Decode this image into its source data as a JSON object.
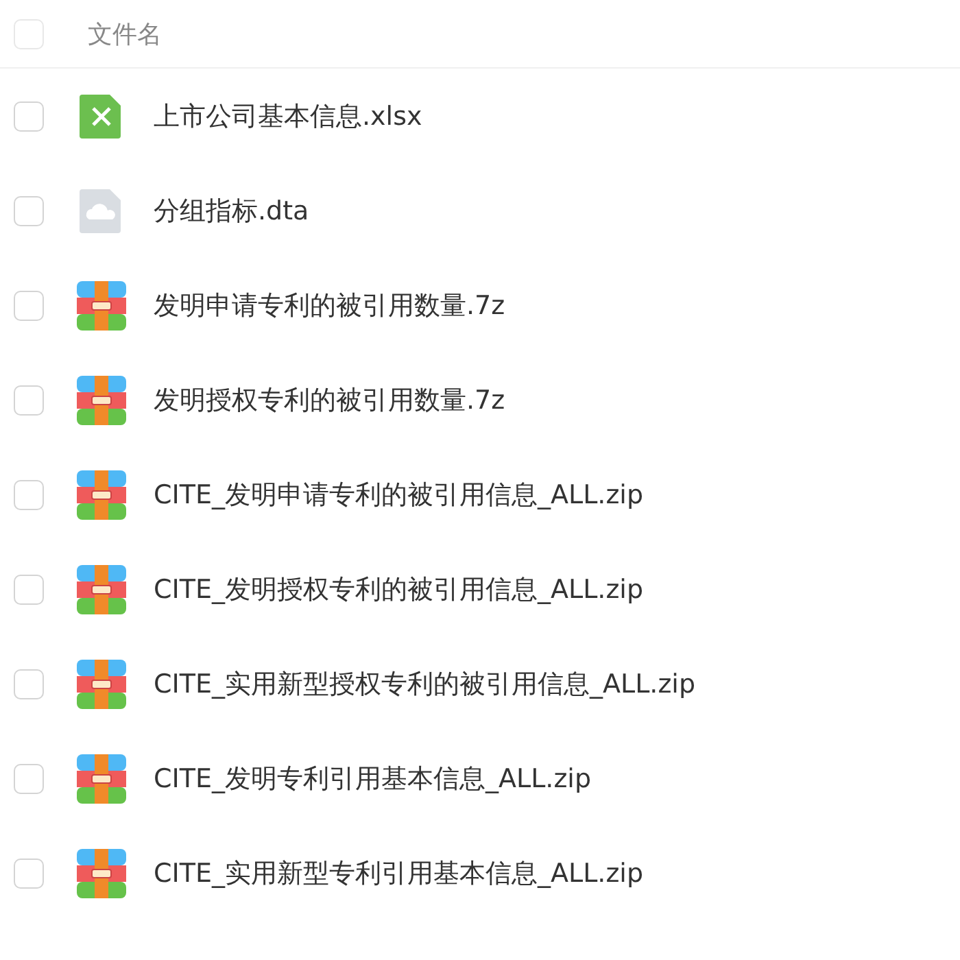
{
  "header": {
    "checked": false,
    "label": "文件名"
  },
  "files": [
    {
      "name": "上市公司基本信息.xlsx",
      "kind": "excel",
      "checked": false
    },
    {
      "name": "分组指标.dta",
      "kind": "cloud",
      "checked": false
    },
    {
      "name": "发明申请专利的被引用数量.7z",
      "kind": "archive",
      "checked": false
    },
    {
      "name": "发明授权专利的被引用数量.7z",
      "kind": "archive",
      "checked": false
    },
    {
      "name": "CITE_发明申请专利的被引用信息_ALL.zip",
      "kind": "archive",
      "checked": false
    },
    {
      "name": "CITE_发明授权专利的被引用信息_ALL.zip",
      "kind": "archive",
      "checked": false
    },
    {
      "name": "CITE_实用新型授权专利的被引用信息_ALL.zip",
      "kind": "archive",
      "checked": false
    },
    {
      "name": "CITE_发明专利引用基本信息_ALL.zip",
      "kind": "archive",
      "checked": false
    },
    {
      "name": "CITE_实用新型专利引用基本信息_ALL.zip",
      "kind": "archive",
      "checked": false
    }
  ]
}
